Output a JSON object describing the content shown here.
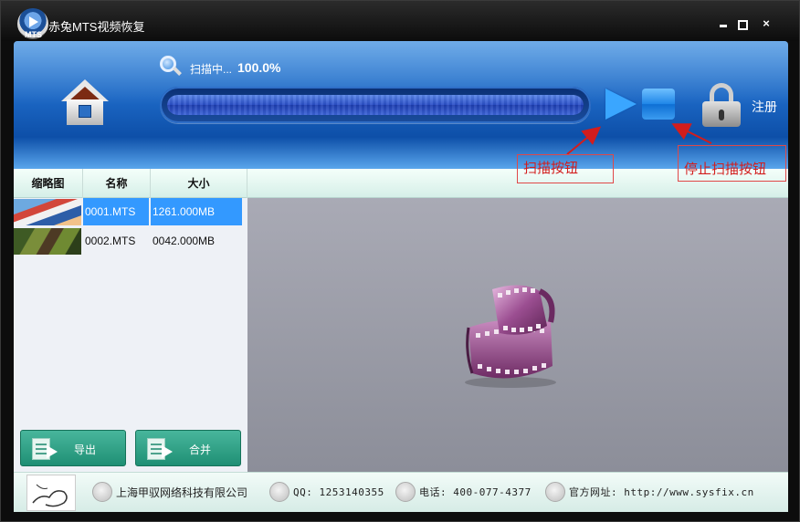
{
  "window": {
    "title": "赤兔MTS视频恢复",
    "logo_text": "MTS",
    "controls": {
      "minimize": "",
      "maximize": "",
      "close": "×"
    }
  },
  "header": {
    "scan_status": "扫描中...",
    "scan_percent": "100.0%",
    "progress": 1.0,
    "register_label": "注册"
  },
  "table": {
    "columns": [
      "缩略图",
      "名称",
      "大小"
    ],
    "rows": [
      {
        "name": "0001.MTS",
        "size": "1261.000MB",
        "selected": true
      },
      {
        "name": "0002.MTS",
        "size": "0042.000MB",
        "selected": false
      }
    ]
  },
  "actions": {
    "export_label": "导出",
    "merge_label": "合并"
  },
  "footer": {
    "company": "上海甲驭网络科技有限公司",
    "qq": "QQ: 1253140355",
    "phone": "电话: 400-077-4377",
    "website": "官方网址: http://www.sysfix.cn"
  },
  "annotations": {
    "scan_button": "扫描按钮",
    "stop_button": "停止扫描按钮"
  },
  "colors": {
    "accent_blue": "#1c67c4",
    "selection": "#3399ff",
    "action_green": "#2a9c80",
    "annotation_red": "#d21d1d"
  },
  "icons": {
    "home": "home-icon",
    "search": "search-icon",
    "scan": "play-icon",
    "stop": "stop-icon",
    "lock": "lock-icon",
    "film": "film-reel-icon"
  }
}
